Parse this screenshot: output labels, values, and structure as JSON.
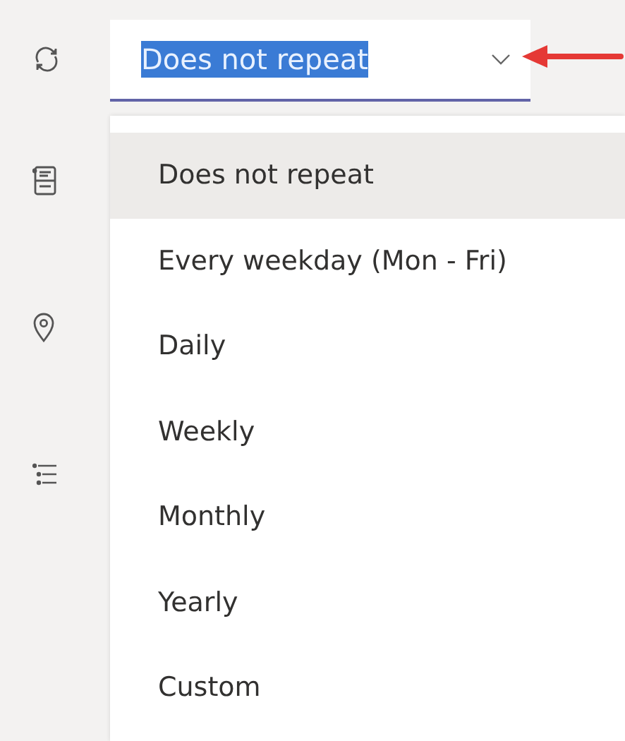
{
  "repeat_field": {
    "value": "Does not repeat",
    "text_selected": true
  },
  "options": [
    {
      "label": "Does not repeat",
      "selected": true
    },
    {
      "label": "Every weekday (Mon - Fri)",
      "selected": false
    },
    {
      "label": "Daily",
      "selected": false
    },
    {
      "label": "Weekly",
      "selected": false
    },
    {
      "label": "Monthly",
      "selected": false
    },
    {
      "label": "Yearly",
      "selected": false
    },
    {
      "label": "Custom",
      "selected": false
    }
  ]
}
